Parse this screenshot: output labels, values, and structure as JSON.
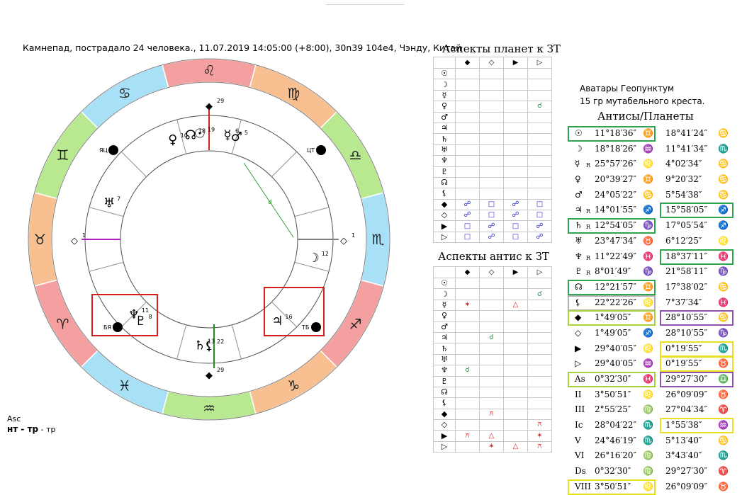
{
  "header": "Камнепад, пострадало 24 человека., 11.07.2019 14:05:00 (+8:00), 30n39 104e4, Чэнду, Китай",
  "legend": {
    "asc": "Asc",
    "line1_bold": "нт - тр",
    "line1_tail": " - тр"
  },
  "avatars": {
    "line1": "Аватары Геопунктум",
    "line2": "15 гр мутабельного креста."
  },
  "antis_title": "Антисы/Планеты",
  "colors": {
    "green": "#2da44e",
    "red": "#d62020",
    "yellow": "#e8e020",
    "purple": "#9050b0",
    "gray": "#b0b0b0",
    "lime": "#a8d038"
  },
  "table1": {
    "title": "Аспекты планет к ЗТ",
    "rows": [
      "☉",
      "☽",
      "☿",
      "♀",
      "♂",
      "♃",
      "♄",
      "♅",
      "♆",
      "♇",
      "☊",
      "⚸",
      "◆",
      "◇",
      "▶",
      "▷"
    ],
    "cols": [
      "◆",
      "◇",
      "▶",
      "▷"
    ],
    "cells": [
      [
        "",
        "",
        "",
        ""
      ],
      [
        "",
        "",
        "",
        ""
      ],
      [
        "",
        "",
        "",
        ""
      ],
      [
        "",
        "",
        "",
        "☌"
      ],
      [
        "",
        "",
        "",
        ""
      ],
      [
        "",
        "",
        "",
        ""
      ],
      [
        "",
        "",
        "",
        ""
      ],
      [
        "",
        "",
        "",
        ""
      ],
      [
        "",
        "",
        "",
        ""
      ],
      [
        "",
        "",
        "",
        ""
      ],
      [
        "",
        "",
        "",
        ""
      ],
      [
        "",
        "",
        "",
        ""
      ],
      [
        "☍",
        "□",
        "☍",
        "□"
      ],
      [
        "☍",
        "□",
        "☍",
        "□"
      ],
      [
        "□",
        "☍",
        "□",
        "☍"
      ],
      [
        "□",
        "☍",
        "□",
        "☍"
      ]
    ]
  },
  "table2": {
    "title": "Аспекты антис к ЗТ",
    "rows": [
      "☉",
      "☽",
      "☿",
      "♀",
      "♂",
      "♃",
      "♄",
      "♅",
      "♆",
      "♇",
      "☊",
      "⚸",
      "◆",
      "◇",
      "▶",
      "▷"
    ],
    "cols": [
      "◆",
      "◇",
      "▶",
      "▷"
    ],
    "cells": [
      [
        "",
        "",
        "",
        ""
      ],
      [
        "",
        "",
        "",
        "☌"
      ],
      [
        "✶",
        "",
        "△",
        ""
      ],
      [
        "",
        "",
        "",
        ""
      ],
      [
        "",
        "",
        "",
        ""
      ],
      [
        "",
        "☌",
        "",
        ""
      ],
      [
        "",
        "",
        "",
        ""
      ],
      [
        "",
        "",
        "",
        ""
      ],
      [
        "☌",
        "",
        "",
        ""
      ],
      [
        "",
        "",
        "",
        ""
      ],
      [
        "",
        "",
        "",
        ""
      ],
      [
        "",
        "",
        "",
        ""
      ],
      [
        "",
        "⚻",
        "",
        ""
      ],
      [
        "",
        "",
        "",
        "⚻"
      ],
      [
        "⚻",
        "△",
        "",
        "✶"
      ],
      [
        "",
        "✶",
        "△",
        "⚻"
      ]
    ]
  },
  "table3": {
    "rows": [
      {
        "sym": "☉",
        "r": "",
        "pos": "11°18′36″",
        "sign": "♊",
        "anti": "18°41′24″",
        "asign": "♋",
        "lbox": "green",
        "rbox": ""
      },
      {
        "sym": "☽",
        "r": "",
        "pos": "18°18′26″",
        "sign": "♒",
        "anti": "11°41′34″",
        "asign": "♏",
        "lbox": "",
        "rbox": ""
      },
      {
        "sym": "☿",
        "r": "R",
        "pos": "25°57′26″",
        "sign": "♌",
        "anti": "4°02′34″",
        "asign": "♋",
        "lbox": "",
        "rbox": ""
      },
      {
        "sym": "♀",
        "r": "",
        "pos": "20°39′27″",
        "sign": "♊",
        "anti": "9°20′32″",
        "asign": "♋",
        "lbox": "",
        "rbox": ""
      },
      {
        "sym": "♂",
        "r": "",
        "pos": "24°05′22″",
        "sign": "♋",
        "anti": "5°54′38″",
        "asign": "♋",
        "lbox": "",
        "rbox": ""
      },
      {
        "sym": "♃",
        "r": "R",
        "pos": "14°01′55″",
        "sign": "♐",
        "anti": "15°58′05″",
        "asign": "♐",
        "lbox": "",
        "rbox": "green"
      },
      {
        "sym": "♄",
        "r": "R",
        "pos": "12°54′05″",
        "sign": "♑",
        "anti": "17°05′54″",
        "asign": "♐",
        "lbox": "green",
        "rbox": ""
      },
      {
        "sym": "♅",
        "r": "",
        "pos": "23°47′34″",
        "sign": "♉",
        "anti": "6°12′25″",
        "asign": "♌",
        "lbox": "",
        "rbox": ""
      },
      {
        "sym": "♆",
        "r": "R",
        "pos": "11°22′49″",
        "sign": "♓",
        "anti": "18°37′11″",
        "asign": "♓",
        "lbox": "",
        "rbox": "green"
      },
      {
        "sym": "♇",
        "r": "R",
        "pos": "8°01′49″",
        "sign": "♑",
        "anti": "21°58′11″",
        "asign": "♑",
        "lbox": "",
        "rbox": ""
      },
      {
        "sym": "☊",
        "r": "",
        "pos": "12°21′57″",
        "sign": "♊",
        "anti": "17°38′02″",
        "asign": "♋",
        "lbox": "green",
        "rbox": ""
      },
      {
        "sym": "⚸",
        "r": "",
        "pos": "22°22′26″",
        "sign": "♌",
        "anti": "7°37′34″",
        "asign": "♓",
        "lbox": "gray",
        "rbox": ""
      },
      {
        "sym": "◆",
        "r": "",
        "pos": "1°49′05″",
        "sign": "♊",
        "anti": "28°10′55″",
        "asign": "♋",
        "lbox": "lime",
        "rbox": "purple"
      },
      {
        "sym": "◇",
        "r": "",
        "pos": "1°49′05″",
        "sign": "♐",
        "anti": "28°10′55″",
        "asign": "♑",
        "lbox": "",
        "rbox": ""
      },
      {
        "sym": "▶",
        "r": "",
        "pos": "29°40′05″",
        "sign": "♌",
        "anti": "0°19′55″",
        "asign": "♏",
        "lbox": "",
        "rbox": "yellow"
      },
      {
        "sym": "▷",
        "r": "",
        "pos": "29°40′05″",
        "sign": "♒",
        "anti": "0°19′55″",
        "asign": "♉",
        "lbox": "",
        "rbox": "yellow"
      },
      {
        "sym": "As",
        "r": "",
        "pos": "0°32′30″",
        "sign": "♓",
        "anti": "29°27′30″",
        "asign": "♎",
        "lbox": "lime",
        "rbox": "purple"
      },
      {
        "sym": "II",
        "r": "",
        "pos": "3°50′51″",
        "sign": "♌",
        "anti": "26°09′09″",
        "asign": "♉",
        "lbox": "",
        "rbox": ""
      },
      {
        "sym": "III",
        "r": "",
        "pos": "2°55′25″",
        "sign": "♍",
        "anti": "27°04′34″",
        "asign": "♈",
        "lbox": "",
        "rbox": ""
      },
      {
        "sym": "Ic",
        "r": "",
        "pos": "28°04′22″",
        "sign": "♏",
        "anti": "1°55′38″",
        "asign": "♒",
        "lbox": "",
        "rbox": "yellow"
      },
      {
        "sym": "V",
        "r": "",
        "pos": "24°46′19″",
        "sign": "♏",
        "anti": "5°13′40″",
        "asign": "♋",
        "lbox": "",
        "rbox": ""
      },
      {
        "sym": "VI",
        "r": "",
        "pos": "26°16′20″",
        "sign": "♍",
        "anti": "3°43′40″",
        "asign": "♏",
        "lbox": "",
        "rbox": ""
      },
      {
        "sym": "Ds",
        "r": "",
        "pos": "0°32′30″",
        "sign": "♍",
        "anti": "29°27′30″",
        "asign": "♈",
        "lbox": "",
        "rbox": ""
      },
      {
        "sym": "VIII",
        "r": "",
        "pos": "3°50′51″",
        "sign": "♌",
        "anti": "26°09′09″",
        "asign": "♉",
        "lbox": "yellow",
        "rbox": ""
      }
    ]
  },
  "chart_data": {
    "type": "astrological-wheel",
    "zodiac": [
      {
        "glyph": "♌",
        "color": "#f4a0a0"
      },
      {
        "glyph": "♋",
        "color": "#a8e0f8"
      },
      {
        "glyph": "♊",
        "color": "#b8e890"
      },
      {
        "glyph": "♉",
        "color": "#f8c090"
      },
      {
        "glyph": "♈",
        "color": "#f4a0a0"
      },
      {
        "glyph": "♓",
        "color": "#a8e0f8"
      },
      {
        "glyph": "♒",
        "color": "#b8e890"
      },
      {
        "glyph": "♑",
        "color": "#f8c090"
      },
      {
        "glyph": "♐",
        "color": "#f4a0a0"
      },
      {
        "glyph": "♏",
        "color": "#a8e0f8"
      },
      {
        "glyph": "♎",
        "color": "#b8e890"
      },
      {
        "glyph": "♍",
        "color": "#f8c090"
      }
    ],
    "points": [
      {
        "glyph": "◆",
        "deg": "29",
        "dir": 180
      },
      {
        "glyph": "◆",
        "deg": "29",
        "dir": 0
      },
      {
        "glyph": "◇",
        "deg": "1",
        "dir": 90
      },
      {
        "glyph": "◇",
        "deg": "1",
        "dir": 270
      },
      {
        "glyph": "☿",
        "deg": "6",
        "dir": 190
      },
      {
        "glyph": "♂",
        "deg": "5",
        "dir": 195
      },
      {
        "glyph": "☉",
        "deg": "19",
        "dir": 175
      },
      {
        "glyph": "☊",
        "deg": "18",
        "dir": 170
      },
      {
        "glyph": "♀",
        "deg": "10",
        "dir": 160
      },
      {
        "glyph": "♅",
        "deg": "7",
        "dir": 110
      },
      {
        "glyph": "☽",
        "deg": "12",
        "dir": 280
      },
      {
        "glyph": "♃",
        "deg": "16",
        "dir": 320
      },
      {
        "glyph": "♆",
        "deg": "11",
        "dir": 45
      },
      {
        "glyph": "♇",
        "deg": "8",
        "dir": 40
      },
      {
        "glyph": "♄",
        "deg": "13",
        "dir": 5
      },
      {
        "glyph": "⚸",
        "deg": "22",
        "dir": 0
      }
    ],
    "markers": [
      "ЯЦ",
      "ЦТ",
      "БЯ",
      "ТБ"
    ]
  }
}
